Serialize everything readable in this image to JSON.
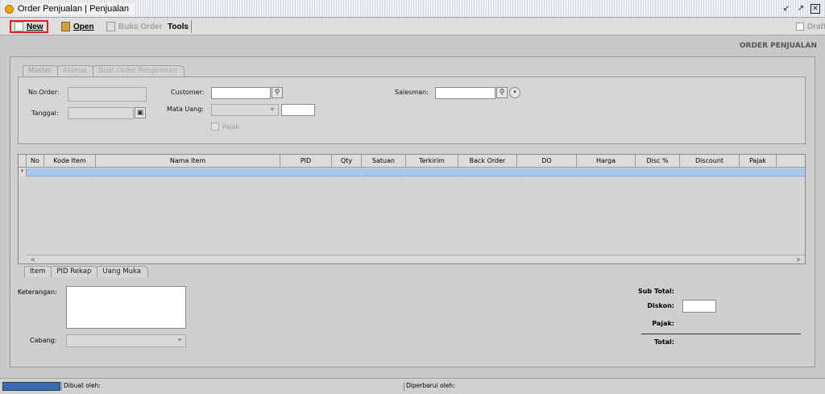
{
  "window": {
    "title": "Order Penjualan | Penjualan"
  },
  "toolbar": {
    "new_label": "New",
    "open_label": "Open",
    "buka_order_label": "Buka Order",
    "tools_label": "Tools",
    "draft_label": "Draft"
  },
  "page": {
    "heading": "ORDER PENJUALAN"
  },
  "top_tabs": [
    "Master",
    "Alamat",
    "Buat Order Pengiriman"
  ],
  "master": {
    "no_order_label": "No.Order:",
    "tanggal_label": "Tanggal:",
    "customer_label": "Customer:",
    "mata_uang_label": "Mata Uang:",
    "pajak_label": "Pajak",
    "salesman_label": "Salesman:"
  },
  "grid": {
    "columns": [
      "No",
      "Kode Item",
      "Nama Item",
      "PID",
      "Qty",
      "Satuan",
      "Terkirim",
      "Back Order",
      "DO",
      "Harga",
      "Disc %",
      "Discount",
      "Pajak"
    ],
    "row_marker": "*"
  },
  "bottom_tabs": [
    "Item",
    "PID Rekap",
    "Uang Muka"
  ],
  "footer": {
    "keterangan_label": "Keterangan:",
    "cabang_label": "Cabang:",
    "sub_total_label": "Sub Total:",
    "diskon_label": "Diskon:",
    "pajak_label": "Pajak:",
    "total_label": "Total:"
  },
  "status": {
    "dibuat_label": "Dibuat oleh:",
    "diperbarui_label": "Diperbarui oleh:"
  },
  "colors": {
    "accent_highlight": "#e02020",
    "row_selected": "#aac8ee",
    "progress": "#3a6ab0"
  }
}
